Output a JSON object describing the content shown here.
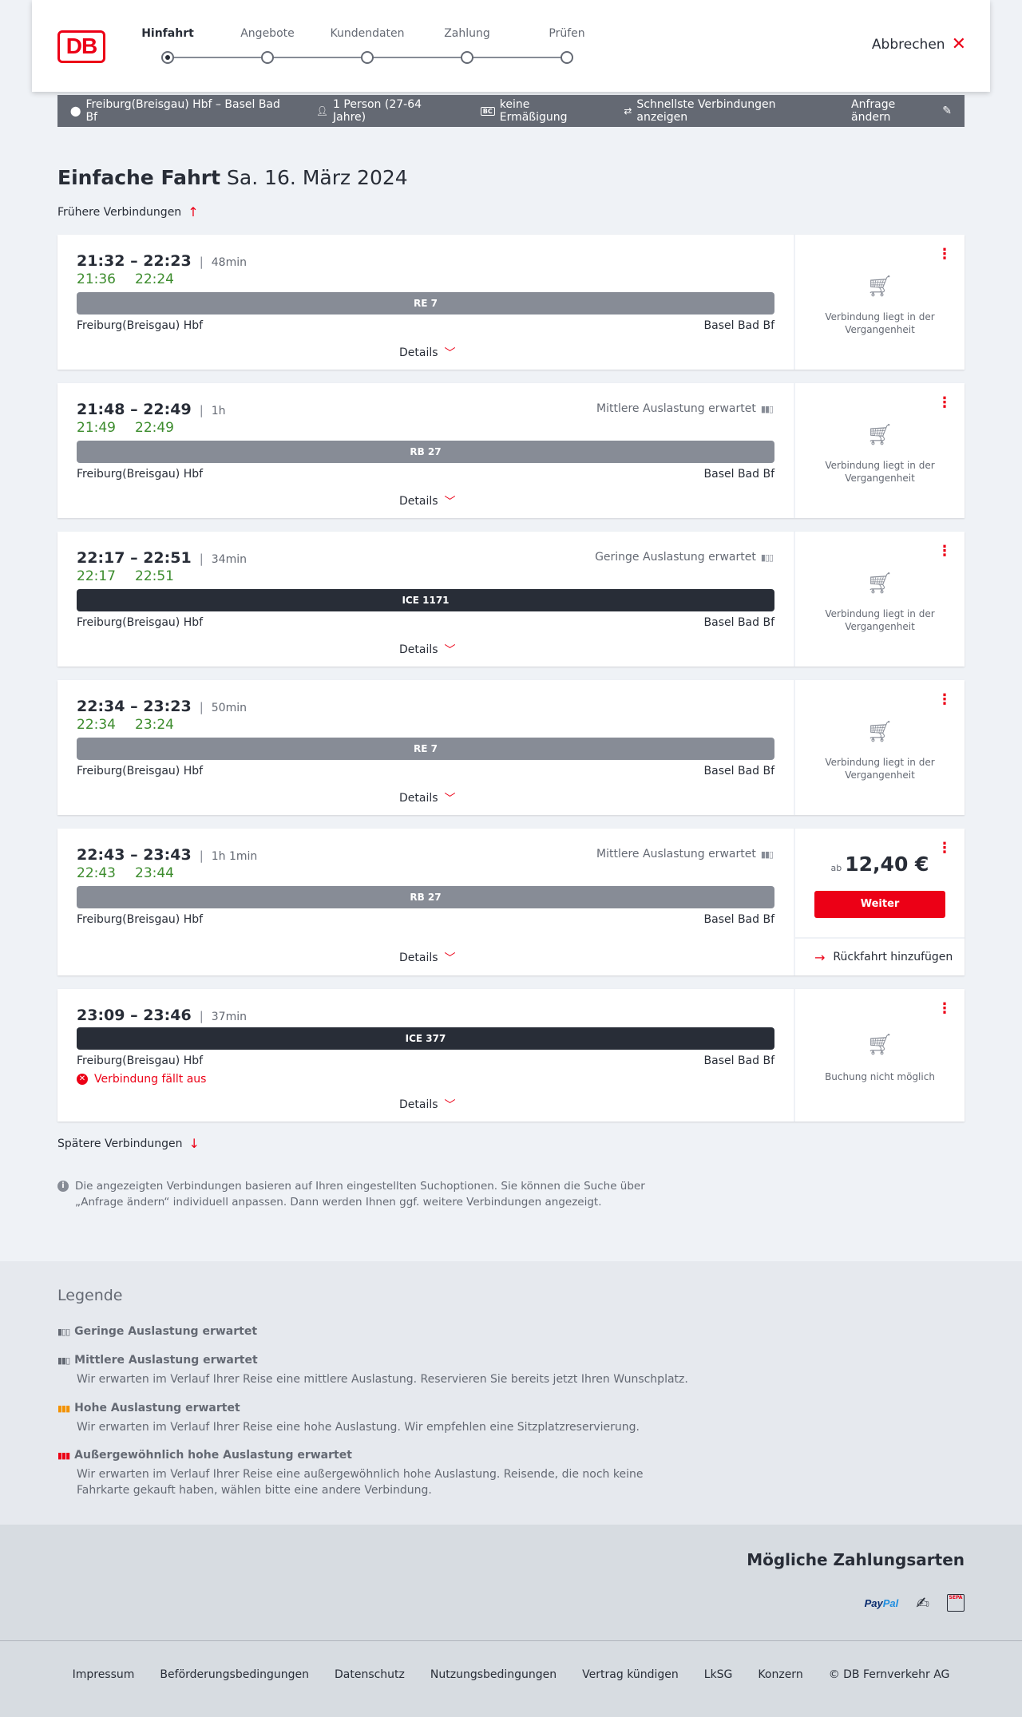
{
  "header": {
    "logo": "DB",
    "steps": [
      {
        "label": "Hinfahrt",
        "active": true
      },
      {
        "label": "Angebote",
        "active": false
      },
      {
        "label": "Kundendaten",
        "active": false
      },
      {
        "label": "Zahlung",
        "active": false
      },
      {
        "label": "Prüfen",
        "active": false
      }
    ],
    "cancel_label": "Abbrechen"
  },
  "query": {
    "route": "Freiburg(Breisgau) Hbf – Basel Bad Bf",
    "travellers": "1 Person (27-64 Jahre)",
    "discount_badge": "BC",
    "discount": "keine Ermäßigung",
    "fastest": "Schnellste Verbindungen anzeigen",
    "edit_label": "Anfrage ändern"
  },
  "title": {
    "bold": "Einfache Fahrt",
    "date": "Sa. 16. März 2024"
  },
  "earlier_label": "Frühere Verbindungen",
  "later_label": "Spätere Verbindungen",
  "connections": [
    {
      "times": "21:32 – 22:23",
      "duration": "48min",
      "rt_dep": "21:36",
      "rt_arr": "22:24",
      "occupancy": "",
      "train": "RE 7",
      "from": "Freiburg(Breisgau) Hbf",
      "to": "Basel Bad Bf",
      "details": "Details",
      "status": "Verbindung liegt in der Vergangenheit"
    },
    {
      "times": "21:48 – 22:49",
      "duration": "1h",
      "rt_dep": "21:49",
      "rt_arr": "22:49",
      "occupancy": "Mittlere Auslastung erwartet",
      "train": "RB 27",
      "from": "Freiburg(Breisgau) Hbf",
      "to": "Basel Bad Bf",
      "details": "Details",
      "status": "Verbindung liegt in der Vergangenheit"
    },
    {
      "times": "22:17 – 22:51",
      "duration": "34min",
      "rt_dep": "22:17",
      "rt_arr": "22:51",
      "occupancy": "Geringe Auslastung erwartet",
      "train": "ICE 1171",
      "from": "Freiburg(Breisgau) Hbf",
      "to": "Basel Bad Bf",
      "details": "Details",
      "status": "Verbindung liegt in der Vergangenheit"
    },
    {
      "times": "22:34 – 23:23",
      "duration": "50min",
      "rt_dep": "22:34",
      "rt_arr": "23:24",
      "occupancy": "",
      "train": "RE 7",
      "from": "Freiburg(Breisgau) Hbf",
      "to": "Basel Bad Bf",
      "details": "Details",
      "status": "Verbindung liegt in der Vergangenheit"
    },
    {
      "times": "22:43 – 23:43",
      "duration": "1h 1min",
      "rt_dep": "22:43",
      "rt_arr": "23:44",
      "occupancy": "Mittlere Auslastung erwartet",
      "train": "RB 27",
      "from": "Freiburg(Breisgau) Hbf",
      "to": "Basel Bad Bf",
      "details": "Details",
      "price_prefix": "ab",
      "price": "12,40 €",
      "continue_label": "Weiter",
      "return_label": "Rückfahrt hinzufügen"
    },
    {
      "times": "23:09 – 23:46",
      "duration": "37min",
      "train": "ICE 377",
      "from": "Freiburg(Breisgau) Hbf",
      "to": "Basel Bad Bf",
      "cancelled": "Verbindung fällt aus",
      "details": "Details",
      "status": "Buchung nicht möglich"
    }
  ],
  "info_text": "Die angezeigten Verbindungen basieren auf Ihren eingestellten Suchoptionen. Sie können die Suche über „Anfrage ändern“ individuell anpassen. Dann werden Ihnen ggf. weitere Verbindungen angezeigt.",
  "legend": {
    "title": "Legende",
    "items": [
      {
        "label": "Geringe Auslastung erwartet",
        "desc": "",
        "color": "#646973"
      },
      {
        "label": "Mittlere Auslastung erwartet",
        "desc": "Wir erwarten im Verlauf Ihrer Reise eine mittlere Auslastung. Reservieren Sie bereits jetzt Ihren Wunschplatz.",
        "color": "#646973"
      },
      {
        "label": "Hohe Auslastung erwartet",
        "desc": "Wir erwarten im Verlauf Ihrer Reise eine hohe Auslastung. Wir empfehlen eine Sitzplatzreservierung.",
        "color": "#f39200"
      },
      {
        "label": "Außergewöhnlich hohe Auslastung erwartet",
        "desc": "Wir erwarten im Verlauf Ihrer Reise eine außergewöhnlich hohe Auslastung. Reisende, die noch keine Fahrkarte gekauft haben, wählen bitte eine andere Verbindung.",
        "color": "#ec0016"
      }
    ]
  },
  "payment": {
    "title": "Mögliche Zahlungsarten",
    "paypal_1": "Pay",
    "paypal_2": "Pal",
    "sepa": "SEPA"
  },
  "footer": [
    "Impressum",
    "Beförderungsbedingungen",
    "Datenschutz",
    "Nutzungsbedingungen",
    "Vertrag kündigen",
    "LkSG",
    "Konzern",
    "© DB Fernverkehr AG"
  ]
}
